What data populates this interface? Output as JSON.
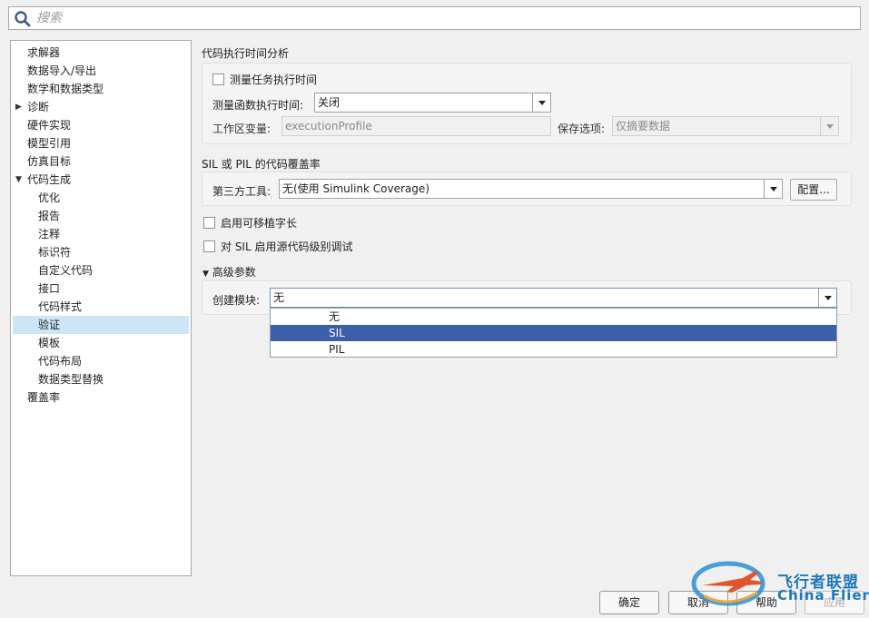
{
  "search": {
    "placeholder": "搜索",
    "value": ""
  },
  "tree": {
    "items": [
      {
        "label": "求解器"
      },
      {
        "label": "数据导入/导出"
      },
      {
        "label": "数学和数据类型"
      },
      {
        "label": "诊断",
        "arrow": "▶"
      },
      {
        "label": "硬件实现"
      },
      {
        "label": "模型引用"
      },
      {
        "label": "仿真目标"
      },
      {
        "label": "代码生成",
        "arrow": "▼"
      },
      {
        "label": "优化"
      },
      {
        "label": "报告"
      },
      {
        "label": "注释"
      },
      {
        "label": "标识符"
      },
      {
        "label": "自定义代码"
      },
      {
        "label": "接口"
      },
      {
        "label": "代码样式"
      },
      {
        "label": "验证"
      },
      {
        "label": "模板"
      },
      {
        "label": "代码布局"
      },
      {
        "label": "数据类型替换"
      },
      {
        "label": "覆盖率"
      }
    ]
  },
  "profiling": {
    "title": "代码执行时间分析",
    "measure_task_label": "测量任务执行时间",
    "measure_func_label": "测量函数执行时间:",
    "measure_func_value": "关闭",
    "workspace_var_label": "工作区变量:",
    "workspace_var_value": "executionProfile",
    "save_option_label": "保存选项:",
    "save_option_value": "仅摘要数据"
  },
  "coverage": {
    "title": "SIL 或 PIL 的代码覆盖率",
    "third_party_label": "第三方工具:",
    "third_party_value": "无(使用 Simulink Coverage)",
    "config_button": "配置..."
  },
  "options": {
    "portable_word_sizes": "启用可移植字长",
    "sil_debug": "对 SIL 启用源代码级别调试"
  },
  "advanced": {
    "title": "高级参数",
    "arrow": "▼",
    "create_block_label": "创建模块:",
    "create_block_value": "无",
    "dropdown_options": [
      "无",
      "SIL",
      "PIL"
    ]
  },
  "footer": {
    "ok": "确定",
    "cancel": "取消",
    "help": "帮助",
    "apply": "应用"
  },
  "watermark": {
    "cn": "飞行者联盟",
    "en": "China Flier"
  }
}
